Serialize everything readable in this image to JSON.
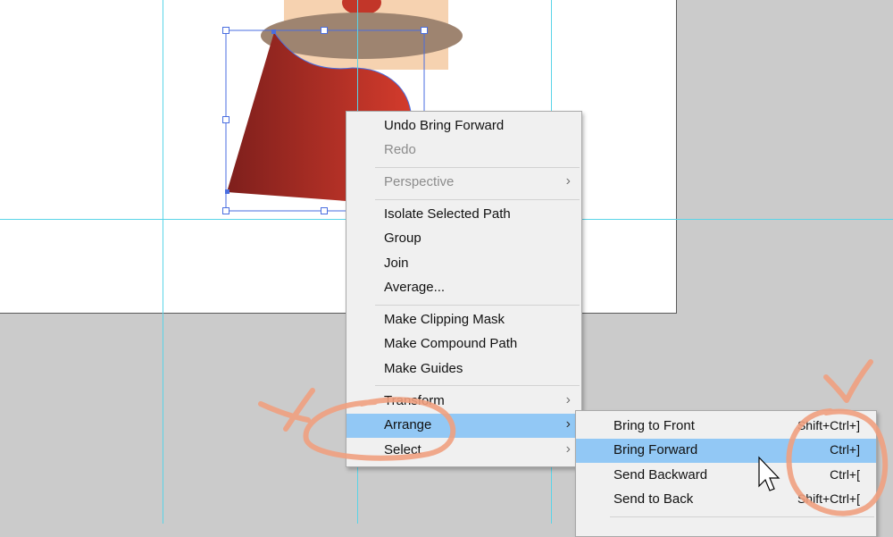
{
  "context_menu": {
    "items": [
      {
        "label": "Undo Bring Forward",
        "disabled": false
      },
      {
        "label": "Redo",
        "disabled": true
      },
      {
        "label": "Perspective",
        "disabled": true,
        "submenu": true
      },
      {
        "label": "Isolate Selected Path",
        "disabled": false
      },
      {
        "label": "Group",
        "disabled": false
      },
      {
        "label": "Join",
        "disabled": false
      },
      {
        "label": "Average...",
        "disabled": false
      },
      {
        "label": "Make Clipping Mask",
        "disabled": false
      },
      {
        "label": "Make Compound Path",
        "disabled": false
      },
      {
        "label": "Make Guides",
        "disabled": false
      },
      {
        "label": "Transform",
        "disabled": false,
        "submenu": true
      },
      {
        "label": "Arrange",
        "disabled": false,
        "submenu": true,
        "active": true
      },
      {
        "label": "Select",
        "disabled": false,
        "submenu": true
      }
    ],
    "submenu_arrow": "›"
  },
  "arrange_submenu": {
    "items": [
      {
        "label": "Bring to Front",
        "shortcut": "Shift+Ctrl+]"
      },
      {
        "label": "Bring Forward",
        "shortcut": "Ctrl+]",
        "active": true
      },
      {
        "label": "Send Backward",
        "shortcut": "Ctrl+["
      },
      {
        "label": "Send to Back",
        "shortcut": "Shift+Ctrl+["
      }
    ]
  },
  "colors": {
    "canvas_bg": "#cbcbcb",
    "artboard": "#ffffff",
    "guides": "#59d4e8",
    "menu_bg": "#f0f0f0",
    "menu_highlight": "#92c8f5",
    "annotation": "#f0a080",
    "shape_dark_red": "#8e2320",
    "shape_red": "#d23a2c",
    "hat_brim": "#9e8470",
    "skin": "#f6d2b0"
  },
  "icons": [
    "mouse-pointer-icon",
    "submenu-arrow-icon"
  ]
}
